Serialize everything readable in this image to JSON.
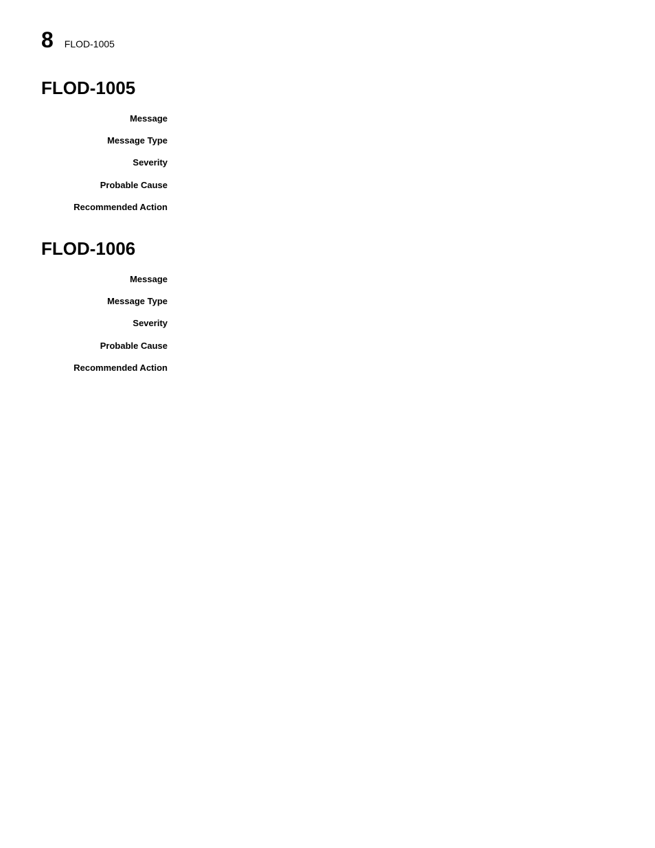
{
  "header": {
    "page_number": "8",
    "title": "FLOD-1005"
  },
  "sections": [
    {
      "id": "flod-1005",
      "title": "FLOD-1005",
      "fields": [
        {
          "label": "Message",
          "value": ""
        },
        {
          "label": "Message Type",
          "value": ""
        },
        {
          "label": "Severity",
          "value": ""
        },
        {
          "label": "Probable Cause",
          "value": ""
        },
        {
          "label": "Recommended Action",
          "value": ""
        }
      ]
    },
    {
      "id": "flod-1006",
      "title": "FLOD-1006",
      "fields": [
        {
          "label": "Message",
          "value": ""
        },
        {
          "label": "Message Type",
          "value": ""
        },
        {
          "label": "Severity",
          "value": ""
        },
        {
          "label": "Probable Cause",
          "value": ""
        },
        {
          "label": "Recommended Action",
          "value": ""
        }
      ]
    }
  ]
}
